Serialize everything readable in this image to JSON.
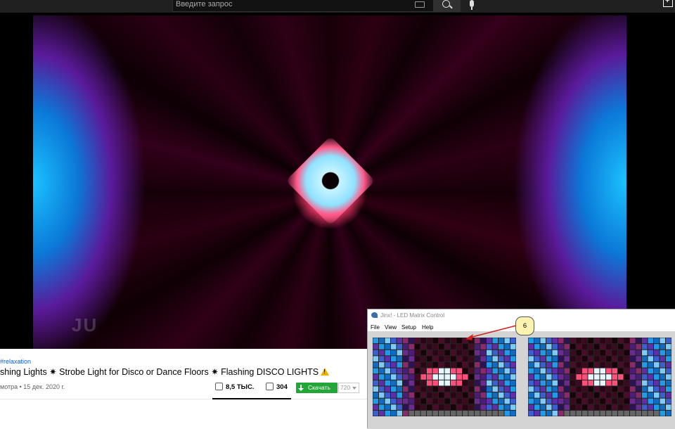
{
  "search": {
    "placeholder": "Введите запрос"
  },
  "icons": {
    "keyboard": "keyboard-icon",
    "search": "search-icon",
    "mic": "mic-icon",
    "create": "create-video-icon",
    "like": "thumb-up-icon",
    "dislike": "thumb-down-icon",
    "download": "download-arrow-icon",
    "warning": "warning-icon"
  },
  "video": {
    "hashtag": "#relaxation",
    "title": "shing Lights ✷ Strobe Light for Disco or Dance Floors ✷ Flashing DISCO LIGHTS",
    "meta": "мотра • 15 дек. 2020 г.",
    "likes": "8,5 ТЫС.",
    "dislikes": "304",
    "download_label": "Скачать",
    "quality": "720",
    "watermark": "JU"
  },
  "app": {
    "title": "Jinx! - LED Matrix Control",
    "menu": [
      "File",
      "View",
      "Setup",
      "Help"
    ]
  },
  "annotation": {
    "number": "6",
    "color": "#d32020"
  },
  "colors": {
    "accent_download": "#23a638",
    "link": "#065fd4",
    "callout_fill": "#fcf3b0"
  }
}
